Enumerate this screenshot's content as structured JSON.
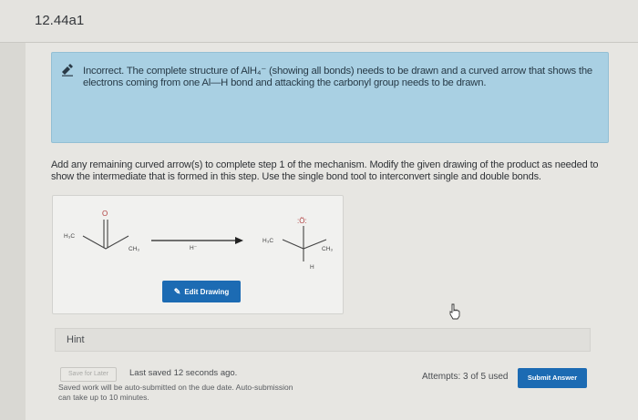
{
  "header": {
    "title": "12.44a1"
  },
  "alert": {
    "icon": "pencil-note-icon",
    "message": "Incorrect. The complete structure of AlH₄⁻ (showing all bonds) needs to be drawn and a curved arrow that shows the electrons coming from one Al—H bond and attacking the carbonyl group needs to be drawn."
  },
  "instructions": "Add any remaining curved arrow(s) to complete step 1 of the mechanism. Modify the given drawing of the product as needed to show the intermediate that is formed in this step. Use the single bond tool to interconvert single and double bonds.",
  "drawing": {
    "reactant_left_label": "H₃C",
    "reactant_right_label": "CH₃",
    "reactant_oxygen": "O",
    "reagent_label": "H⁻",
    "product_left_label": "H₃C",
    "product_right_label": "CH₃",
    "product_oxygen": ":Ö:",
    "product_h": "H",
    "edit_button": "Edit Drawing"
  },
  "hint": {
    "label": "Hint"
  },
  "footer": {
    "save_later": "Save for Later",
    "last_saved": "Last saved 12 seconds ago.",
    "autosubmit": "Saved work will be auto-submitted on the due date. Auto-submission can take up to 10 minutes.",
    "attempts": "Attempts: 3 of 5 used",
    "submit": "Submit Answer"
  }
}
